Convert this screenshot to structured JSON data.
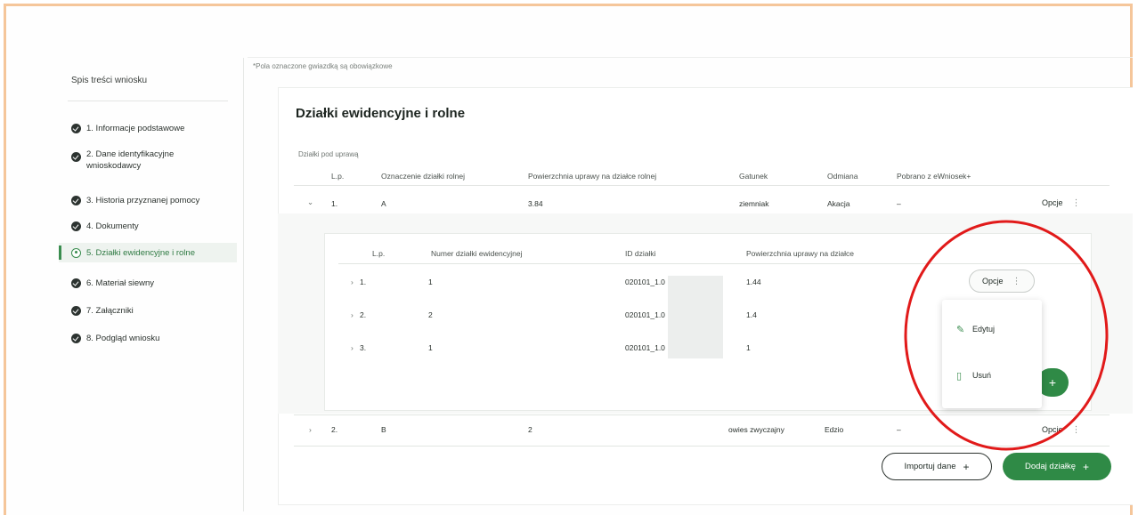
{
  "sidebar": {
    "title": "Spis treści wniosku",
    "steps": [
      {
        "label": "1. Informacje podstawowe"
      },
      {
        "label": "2. Dane identyfikacyjne",
        "label2": "wnioskodawcy"
      },
      {
        "label": "3. Historia przyznanej pomocy"
      },
      {
        "label": "4. Dokumenty"
      },
      {
        "label": "5. Działki ewidencyjne i rolne"
      },
      {
        "label": "6. Materiał siewny"
      },
      {
        "label": "7. Załączniki"
      },
      {
        "label": "8. Podgląd wniosku"
      }
    ]
  },
  "note": "*Pola oznaczone gwiazdką są obowiązkowe",
  "card": {
    "title": "Działki ewidencyjne i rolne",
    "section_label": "Działki pod uprawą",
    "headers": [
      "L.p.",
      "Oznaczenie działki rolnej",
      "Powierzchnia uprawy na działce rolnej",
      "Gatunek",
      "Odmiana",
      "Pobrano z eWniosek+"
    ],
    "rows": [
      {
        "expand": "⌄",
        "lp": "1.",
        "oznaczenie": "A",
        "powierzchnia": "3.84",
        "gatunek": "ziemniak",
        "odmiana": "Akacja",
        "pobrano": "–",
        "options": "Opcje"
      },
      {
        "expand": "›",
        "lp": "2.",
        "oznaczenie": "B",
        "powierzchnia": "2",
        "gatunek": "owies zwyczajny",
        "odmiana": "Edzio",
        "pobrano": "–",
        "options": "Opcje"
      }
    ],
    "inner": {
      "headers": [
        "L.p.",
        "Numer działki ewidencyjnej",
        "ID działki",
        "Powierzchnia uprawy na działce"
      ],
      "rows": [
        {
          "expand": "›",
          "lp": "1.",
          "numer": "1",
          "id": "020101_1.0",
          "powierzchnia": "1.44"
        },
        {
          "expand": "›",
          "lp": "2.",
          "numer": "2",
          "id": "020101_1.0",
          "powierzchnia": "1.4"
        },
        {
          "expand": "›",
          "lp": "3.",
          "numer": "1",
          "id": "020101_1.0",
          "powierzchnia": "1"
        }
      ],
      "options": "Opcje"
    },
    "dropdown": {
      "edit": "Edytuj",
      "delete": "Usuń"
    },
    "import_button": "Importuj dane",
    "add_button": "Dodaj działkę",
    "plus": "+"
  },
  "colors": {
    "accent": "#2f8a46",
    "annotation": "#e11a1a",
    "frame": "#f5c69a"
  }
}
